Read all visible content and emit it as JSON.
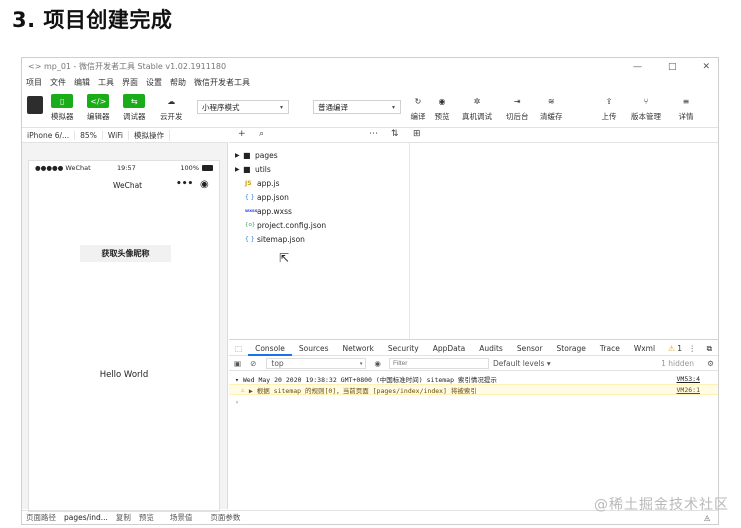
{
  "heading": "3. 项目创建完成",
  "window": {
    "title": "<> mp_01 - 微信开发者工具 Stable v1.02.1911180",
    "controls": [
      "—",
      "□",
      "✕"
    ]
  },
  "menu": [
    "项目",
    "文件",
    "编辑",
    "工具",
    "界面",
    "设置",
    "帮助",
    "微信开发者工具"
  ],
  "toolbar": {
    "simulator": "模拟器",
    "editor": "编辑器",
    "debugger": "调试器",
    "cloud": "云开发",
    "mode_select": "小程序模式",
    "compile_select": "普通编译",
    "compile": "编译",
    "preview": "预览",
    "remote_debug": "真机调试",
    "backstage": "切后台",
    "clear_cache": "清缓存",
    "upload": "上传",
    "version": "版本管理",
    "details": "详情"
  },
  "sim_bar": {
    "device": "iPhone 6/...",
    "zoom": "85%",
    "network": "WiFi",
    "operate": "模拟操作"
  },
  "phone": {
    "carrier": "●●●●● WeChat",
    "time": "19:57",
    "battery": "100%",
    "nav_title": "WeChat",
    "button": "获取头像昵称",
    "hello": "Hello World"
  },
  "tree": [
    {
      "name": "pages",
      "type": "folder",
      "icon": "▸"
    },
    {
      "name": "utils",
      "type": "folder",
      "icon": "▸"
    },
    {
      "name": "app.js",
      "type": "file",
      "icon": "JS"
    },
    {
      "name": "app.json",
      "type": "file",
      "icon": "{ }"
    },
    {
      "name": "app.wxss",
      "type": "file",
      "icon": "wxss"
    },
    {
      "name": "project.config.json",
      "type": "file",
      "icon": "{o}"
    },
    {
      "name": "sitemap.json",
      "type": "file",
      "icon": "{ }"
    }
  ],
  "devtools": {
    "tabs": [
      "Console",
      "Sources",
      "Network",
      "Security",
      "AppData",
      "Audits",
      "Sensor",
      "Storage",
      "Trace",
      "Wxml"
    ],
    "warn_count": "1",
    "context": "top",
    "filter_placeholder": "Filter",
    "levels": "Default levels ▾",
    "hidden": "1 hidden",
    "log_line": "▾ Wed May 20 2020 19:38:32 GMT+0800 (中国标准时间) sitemap 索引情况提示",
    "log_src": "VM53:4",
    "warn_line": "▶  根据 sitemap 的规则[0]，当前页面 [pages/index/index] 将被索引",
    "warn_src": "VM26:1",
    "prompt": "›"
  },
  "bottom": {
    "path_label": "页面路径",
    "path": "pages/ind...",
    "copy": "复制",
    "preview": "预览",
    "scene": "场景值",
    "params": "页面参数"
  },
  "watermark": "@稀土掘金技术社区"
}
